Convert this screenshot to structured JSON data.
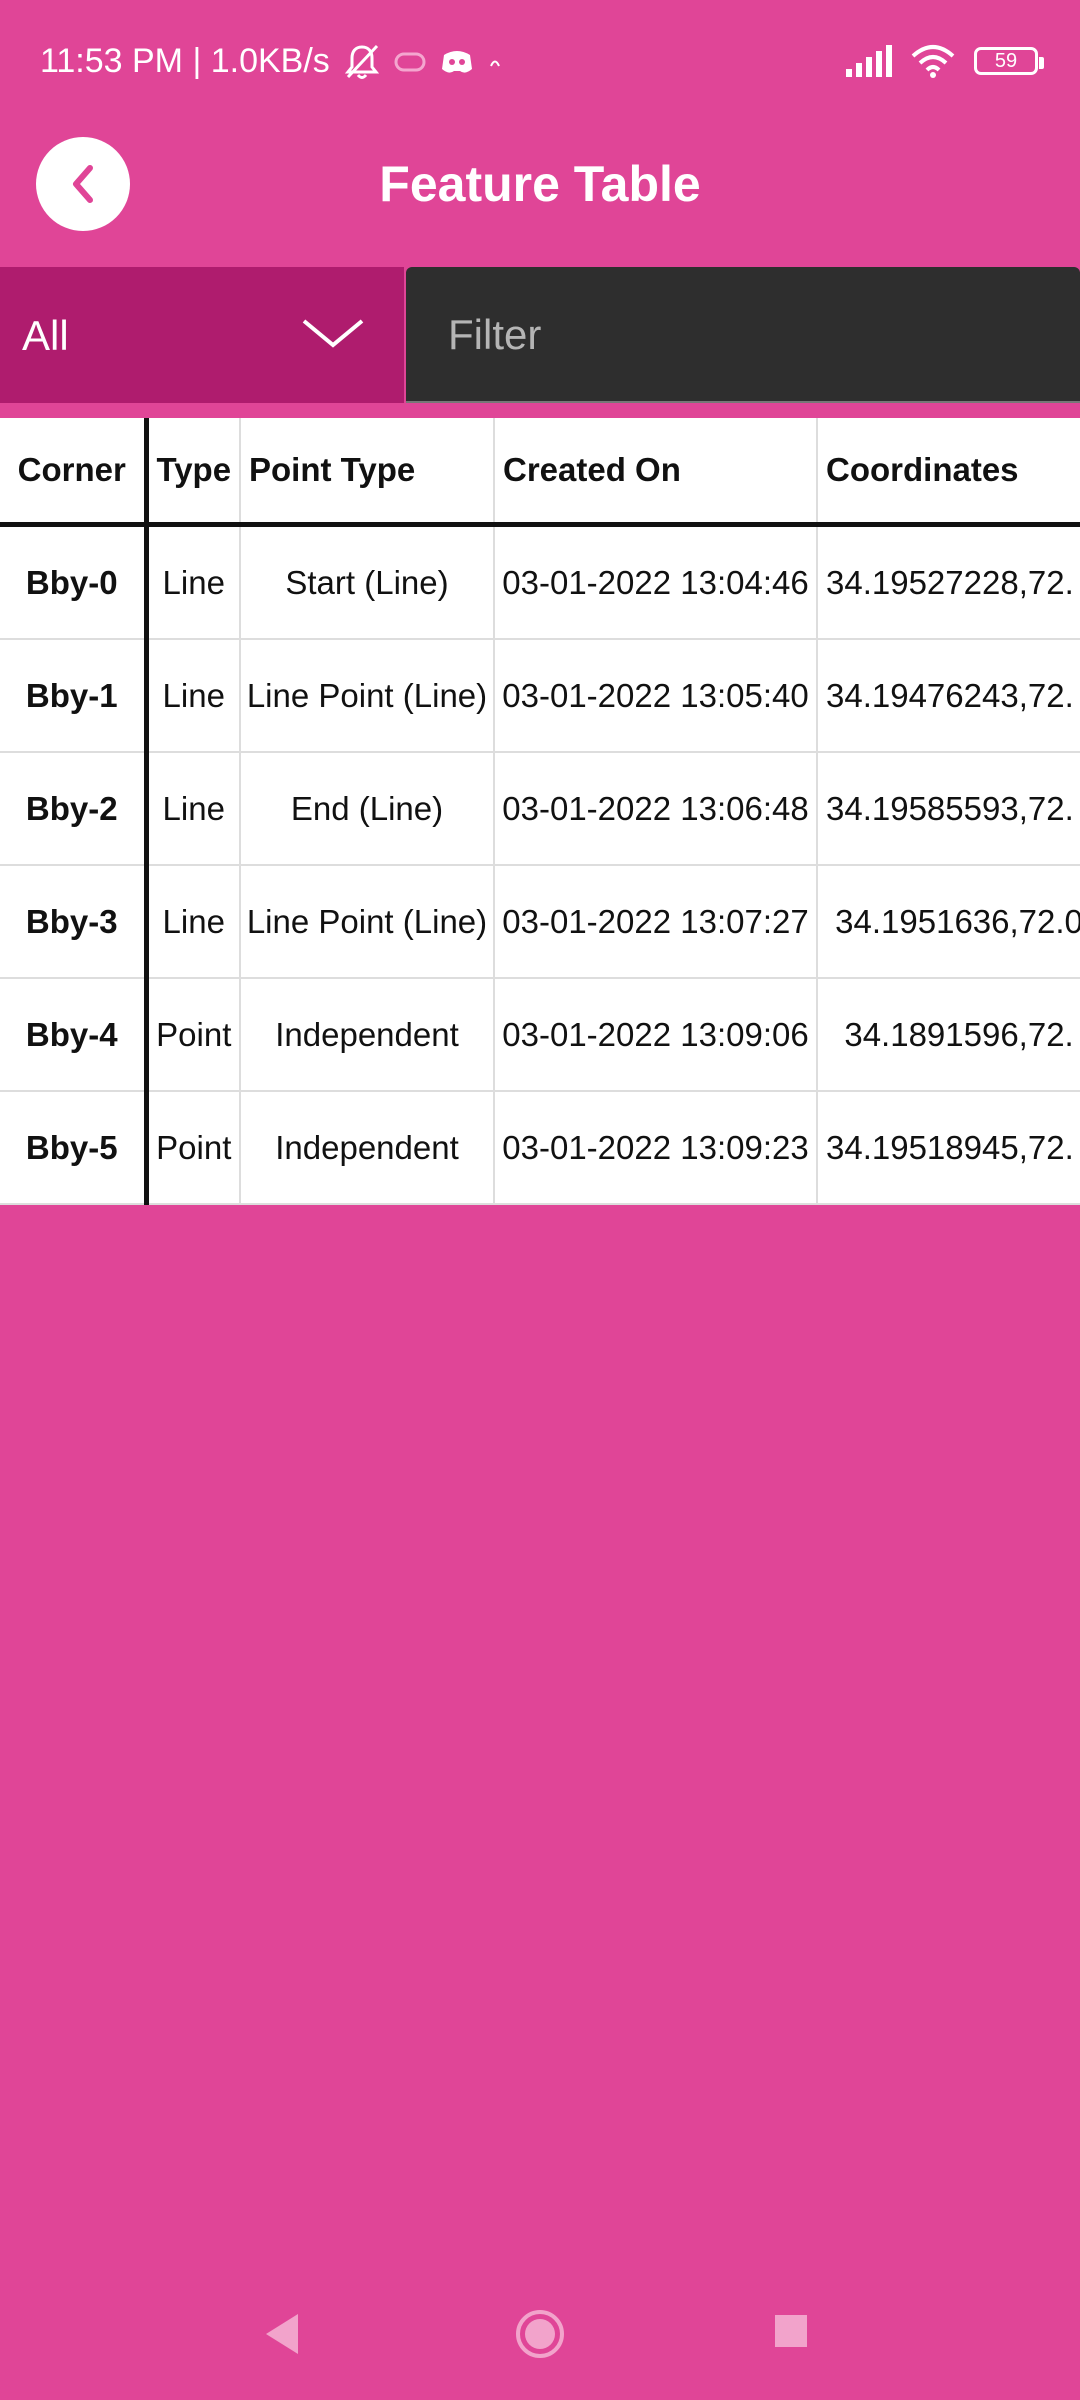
{
  "status_bar": {
    "time_text": "11:53 PM | 1.0KB/s",
    "battery": "59"
  },
  "app_bar": {
    "title": "Feature Table"
  },
  "filter": {
    "selected": "All",
    "placeholder": "Filter"
  },
  "table": {
    "headers": [
      "Corner",
      "Type",
      "Point Type",
      "Created On",
      "Coordinates"
    ],
    "rows": [
      [
        "Bby-0",
        "Line",
        "Start (Line)",
        "03-01-2022 13:04:46",
        "34.19527228,72."
      ],
      [
        "Bby-1",
        "Line",
        "Line Point (Line)",
        "03-01-2022 13:05:40",
        "34.19476243,72."
      ],
      [
        "Bby-2",
        "Line",
        "End (Line)",
        "03-01-2022 13:06:48",
        "34.19585593,72."
      ],
      [
        "Bby-3",
        "Line",
        "Line Point (Line)",
        "03-01-2022 13:07:27",
        " 34.1951636,72.0"
      ],
      [
        "Bby-4",
        "Point",
        "Independent",
        "03-01-2022 13:09:06",
        "  34.1891596,72."
      ],
      [
        "Bby-5",
        "Point",
        "Independent",
        "03-01-2022 13:09:23",
        "34.19518945,72."
      ]
    ]
  },
  "colors": {
    "background": "#E04597",
    "select_bg": "#AF1C6E",
    "filter_bg": "#2E2E2E"
  }
}
